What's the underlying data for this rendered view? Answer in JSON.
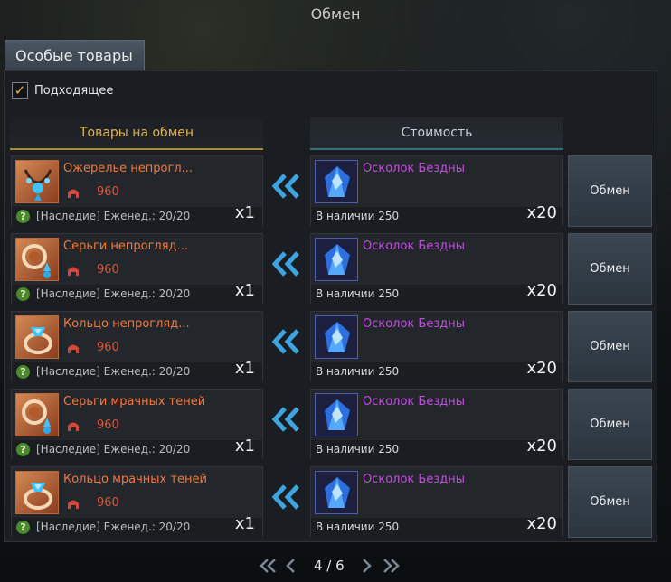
{
  "window": {
    "title": "Обмен"
  },
  "tab": {
    "label": "Особые товары"
  },
  "filter": {
    "label": "Подходящее",
    "checked": true
  },
  "columns": {
    "goods": "Товары на обмен",
    "cost": "Стоимость"
  },
  "rows": [
    {
      "item_name": "Ожерелье непрогл...",
      "item_icon": "necklace-icon",
      "level": "960",
      "limit": "[Наследие] Еженед.: 20/20",
      "item_qty": "x1",
      "cost_name": "Осколок Бездны",
      "cost_icon": "abyss-shard-icon",
      "stock": "В наличии 250",
      "cost_qty": "x20",
      "button": "Обмен"
    },
    {
      "item_name": "Серьги непрогляд...",
      "item_icon": "earrings-icon",
      "level": "960",
      "limit": "[Наследие] Еженед.: 20/20",
      "item_qty": "x1",
      "cost_name": "Осколок Бездны",
      "cost_icon": "abyss-shard-icon",
      "stock": "В наличии 250",
      "cost_qty": "x20",
      "button": "Обмен"
    },
    {
      "item_name": "Кольцо непрогляд...",
      "item_icon": "ring-icon",
      "level": "960",
      "limit": "[Наследие] Еженед.: 20/20",
      "item_qty": "x1",
      "cost_name": "Осколок Бездны",
      "cost_icon": "abyss-shard-icon",
      "stock": "В наличии 250",
      "cost_qty": "x20",
      "button": "Обмен"
    },
    {
      "item_name": "Серьги мрачных теней",
      "item_icon": "earrings-icon",
      "level": "960",
      "limit": "[Наследие] Еженед.: 20/20",
      "item_qty": "x1",
      "cost_name": "Осколок Бездны",
      "cost_icon": "abyss-shard-icon",
      "stock": "В наличии 250",
      "cost_qty": "x20",
      "button": "Обмен"
    },
    {
      "item_name": "Кольцо мрачных теней",
      "item_icon": "ring-icon",
      "level": "960",
      "limit": "[Наследие] Еженед.: 20/20",
      "item_qty": "x1",
      "cost_name": "Осколок Бездны",
      "cost_icon": "abyss-shard-icon",
      "stock": "В наличии 250",
      "cost_qty": "x20",
      "button": "Обмен"
    }
  ],
  "pagination": {
    "label": "4 / 6"
  },
  "colors": {
    "item_name": "#f07840",
    "cost_name": "#c24fe0",
    "goods_header": "#e0b24a",
    "level": "#e0533c"
  }
}
